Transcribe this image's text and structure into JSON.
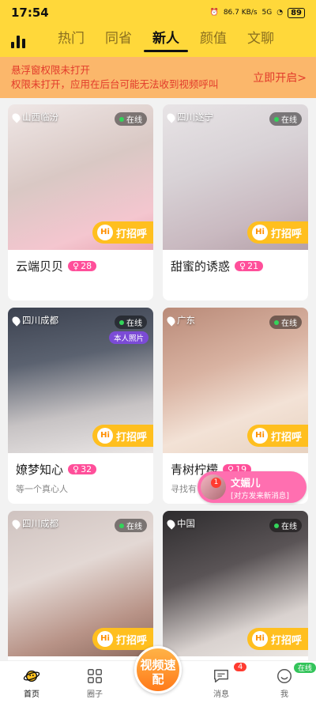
{
  "status": {
    "time": "17:54",
    "speed": "86.7 KB/s",
    "network": "5G",
    "battery": "89"
  },
  "tabs": [
    {
      "label": "热门",
      "active": false
    },
    {
      "label": "同省",
      "active": false
    },
    {
      "label": "新人",
      "active": true
    },
    {
      "label": "颜值",
      "active": false
    },
    {
      "label": "文聊",
      "active": false
    }
  ],
  "banner": {
    "line1": "悬浮窗权限未打开",
    "line2": "权限未打开，应用在后台可能无法收到视频呼叫",
    "action": "立即开启>"
  },
  "cards": [
    {
      "location": "山西临汾",
      "online": "在线",
      "name": "云端贝贝",
      "age": "28",
      "sign": "",
      "greet": "打招呼",
      "real": ""
    },
    {
      "location": "四川遂宁",
      "online": "在线",
      "name": "甜蜜的诱惑",
      "age": "21",
      "sign": "",
      "greet": "打招呼",
      "real": ""
    },
    {
      "location": "四川成都",
      "online": "在线",
      "name": "嫽梦知心",
      "age": "32",
      "sign": "等一个真心人",
      "greet": "打招呼",
      "real": "本人照片"
    },
    {
      "location": "广东",
      "online": "在线",
      "name": "青树柠檬",
      "age": "19",
      "sign": "寻找有",
      "greet": "打招呼",
      "real": ""
    },
    {
      "location": "四川成都",
      "online": "在线",
      "name": "",
      "age": "",
      "sign": "",
      "greet": "打招呼",
      "real": ""
    },
    {
      "location": "中国",
      "online": "在线",
      "name": "",
      "age": "",
      "sign": "",
      "greet": "打招呼",
      "real": ""
    }
  ],
  "message": {
    "from": "文媚儿",
    "tip": "[对方发来新消息]",
    "count": "1"
  },
  "bottom": {
    "home": "首页",
    "circle": "圈子",
    "center": "视频速配",
    "messages": "消息",
    "messages_badge": "4",
    "me": "我",
    "me_tag": "在线"
  },
  "colors": {
    "brand": "#ffd83a",
    "accent": "#ffbf1f",
    "pink": "#ff4f9a"
  }
}
